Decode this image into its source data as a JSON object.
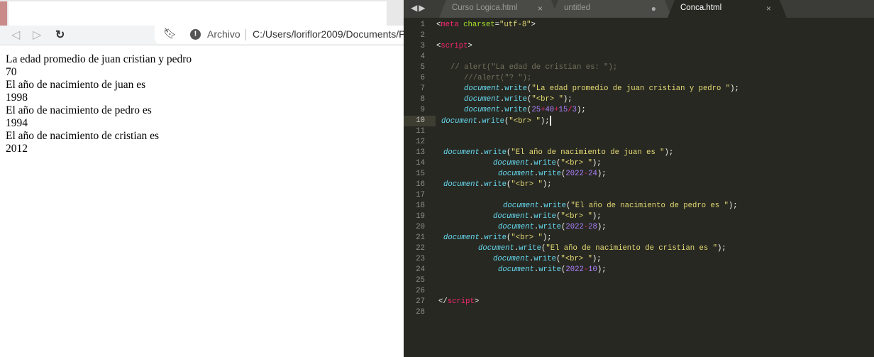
{
  "browser": {
    "nav": {
      "back_icon": "back-arrow-icon",
      "forward_icon": "forward-arrow-icon",
      "reload_icon": "reload-icon",
      "bookmark_icon": "bookmark-icon",
      "info_icon": "info-icon"
    },
    "omnibox": {
      "scheme_label": "Archivo",
      "url": "C:/Users/loriflor2009/Documents/P"
    },
    "content_lines": [
      "La edad promedio de juan cristian y pedro",
      "70",
      "El año de nacimiento de juan es",
      "1998",
      "El año de nacimiento de pedro es",
      "1994",
      "El año de nacimiento de cristian es",
      "2012"
    ]
  },
  "editor": {
    "colors": {
      "background": "#272822",
      "tag": "#f92672",
      "string": "#e6db74",
      "number": "#ae81ff",
      "object": "#66d9ef",
      "comment": "#75715e"
    },
    "tabs": [
      {
        "label": "Curso Logica.html",
        "status": "×"
      },
      {
        "label": "untitled",
        "status": "●"
      },
      {
        "label": "Conca.html",
        "status": "×",
        "active": true
      }
    ],
    "current_line": 10,
    "lines": [
      [
        [
          "tag",
          "<"
        ],
        [
          "tagname",
          "meta"
        ],
        [
          "p",
          " "
        ],
        [
          "attr",
          "charset"
        ],
        [
          "p",
          "="
        ],
        [
          "str",
          "\"utf-8\""
        ],
        [
          "p",
          ">"
        ]
      ],
      [],
      [
        [
          "p",
          "<"
        ],
        [
          "tagname",
          "script"
        ],
        [
          "p",
          ">"
        ]
      ],
      [],
      [
        [
          "com",
          "// alert(\"La edad de cristian es: \");"
        ]
      ],
      [
        [
          "com",
          "///alert(\"? \");"
        ]
      ],
      [
        [
          "obj",
          "document"
        ],
        [
          "p",
          "."
        ],
        [
          "fn",
          "write"
        ],
        [
          "p",
          "("
        ],
        [
          "str",
          "\"La edad promedio de juan cristian y pedro \""
        ],
        [
          "p",
          ");"
        ]
      ],
      [
        [
          "obj",
          "document"
        ],
        [
          "p",
          "."
        ],
        [
          "fn",
          "write"
        ],
        [
          "p",
          "("
        ],
        [
          "str",
          "\"<br> \""
        ],
        [
          "p",
          ");"
        ]
      ],
      [
        [
          "obj",
          "document"
        ],
        [
          "p",
          "."
        ],
        [
          "fn",
          "write"
        ],
        [
          "p",
          "("
        ],
        [
          "num",
          "25"
        ],
        [
          "op",
          "+"
        ],
        [
          "num",
          "40"
        ],
        [
          "op",
          "+"
        ],
        [
          "num",
          "15"
        ],
        [
          "op",
          "/"
        ],
        [
          "num",
          "3"
        ],
        [
          "p",
          ");"
        ]
      ],
      [
        [
          "obj",
          "document"
        ],
        [
          "p",
          "."
        ],
        [
          "fn",
          "write"
        ],
        [
          "p",
          "("
        ],
        [
          "str",
          "\"<br> \""
        ],
        [
          "p",
          ");"
        ]
      ],
      [],
      [],
      [
        [
          "obj",
          "document"
        ],
        [
          "p",
          "."
        ],
        [
          "fn",
          "write"
        ],
        [
          "p",
          "("
        ],
        [
          "str",
          "\"El año de nacimiento de juan es \""
        ],
        [
          "p",
          ");"
        ]
      ],
      [
        [
          "obj",
          "document"
        ],
        [
          "p",
          "."
        ],
        [
          "fn",
          "write"
        ],
        [
          "p",
          "("
        ],
        [
          "str",
          "\"<br> \""
        ],
        [
          "p",
          ");"
        ]
      ],
      [
        [
          "obj",
          "document"
        ],
        [
          "p",
          "."
        ],
        [
          "fn",
          "write"
        ],
        [
          "p",
          "("
        ],
        [
          "num",
          "2022"
        ],
        [
          "op",
          "-"
        ],
        [
          "num",
          "24"
        ],
        [
          "p",
          ");"
        ]
      ],
      [
        [
          "obj",
          "document"
        ],
        [
          "p",
          "."
        ],
        [
          "fn",
          "write"
        ],
        [
          "p",
          "("
        ],
        [
          "str",
          "\"<br> \""
        ],
        [
          "p",
          ");"
        ]
      ],
      [],
      [
        [
          "obj",
          "document"
        ],
        [
          "p",
          "."
        ],
        [
          "fn",
          "write"
        ],
        [
          "p",
          "("
        ],
        [
          "str",
          "\"El año de nacimiento de pedro es \""
        ],
        [
          "p",
          ");"
        ]
      ],
      [
        [
          "obj",
          "document"
        ],
        [
          "p",
          "."
        ],
        [
          "fn",
          "write"
        ],
        [
          "p",
          "("
        ],
        [
          "str",
          "\"<br> \""
        ],
        [
          "p",
          ");"
        ]
      ],
      [
        [
          "obj",
          "document"
        ],
        [
          "p",
          "."
        ],
        [
          "fn",
          "write"
        ],
        [
          "p",
          "("
        ],
        [
          "num",
          "2022"
        ],
        [
          "op",
          "-"
        ],
        [
          "num",
          "28"
        ],
        [
          "p",
          ");"
        ]
      ],
      [
        [
          "obj",
          "document"
        ],
        [
          "p",
          "."
        ],
        [
          "fn",
          "write"
        ],
        [
          "p",
          "("
        ],
        [
          "str",
          "\"<br> \""
        ],
        [
          "p",
          ");"
        ]
      ],
      [
        [
          "obj",
          "document"
        ],
        [
          "p",
          "."
        ],
        [
          "fn",
          "write"
        ],
        [
          "p",
          "("
        ],
        [
          "str",
          "\"El año de nacimiento de cristian es \""
        ],
        [
          "p",
          ");"
        ]
      ],
      [
        [
          "obj",
          "document"
        ],
        [
          "p",
          "."
        ],
        [
          "fn",
          "write"
        ],
        [
          "p",
          "("
        ],
        [
          "str",
          "\"<br> \""
        ],
        [
          "p",
          ");"
        ]
      ],
      [
        [
          "obj",
          "document"
        ],
        [
          "p",
          "."
        ],
        [
          "fn",
          "write"
        ],
        [
          "p",
          "("
        ],
        [
          "num",
          "2022"
        ],
        [
          "op",
          "-"
        ],
        [
          "num",
          "10"
        ],
        [
          "p",
          ");"
        ]
      ],
      [],
      [],
      [
        [
          "p",
          "</"
        ],
        [
          "tagname",
          "script"
        ],
        [
          "p",
          ">"
        ]
      ],
      []
    ]
  }
}
